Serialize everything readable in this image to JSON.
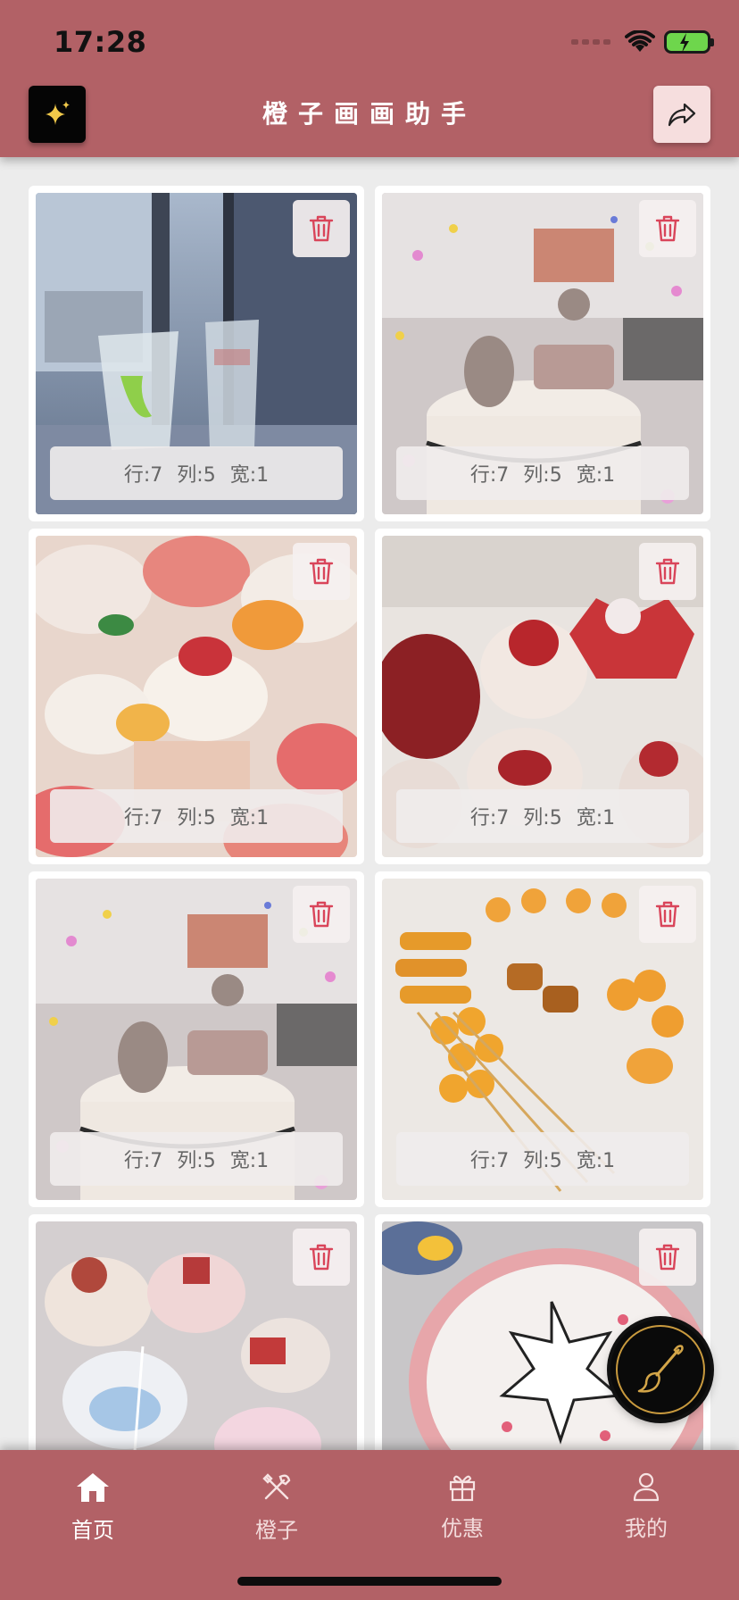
{
  "status": {
    "time": "17:28"
  },
  "header": {
    "title": "橙子画画助手",
    "magic_icon": "sparkles-icon",
    "share_icon": "share-icon"
  },
  "cards": [
    {
      "subject": "glasses-by-window",
      "rows": "行:7",
      "cols": "列:5",
      "width": "宽:1"
    },
    {
      "subject": "birthday-cake-confetti",
      "rows": "行:7",
      "cols": "列:5",
      "width": "宽:1"
    },
    {
      "subject": "fruit-cupcakes",
      "rows": "行:7",
      "cols": "列:5",
      "width": "宽:1"
    },
    {
      "subject": "strawberry-cupcakes-box",
      "rows": "行:7",
      "cols": "列:5",
      "width": "宽:1"
    },
    {
      "subject": "birthday-cake-confetti",
      "rows": "行:7",
      "cols": "列:5",
      "width": "宽:1"
    },
    {
      "subject": "bread-skewers",
      "rows": "行:7",
      "cols": "列:5",
      "width": "宽:1"
    },
    {
      "subject": "decorated-mini-cakes",
      "rows": "",
      "cols": "",
      "width": ""
    },
    {
      "subject": "star-cake",
      "rows": "",
      "cols": "",
      "width": ""
    }
  ],
  "fab": {
    "icon": "paintbrush-icon"
  },
  "tabs": [
    {
      "label": "首页",
      "icon": "home-icon",
      "active": true
    },
    {
      "label": "橙子",
      "icon": "tools-icon",
      "active": false
    },
    {
      "label": "优惠",
      "icon": "gift-icon",
      "active": false
    },
    {
      "label": "我的",
      "icon": "person-icon",
      "active": false
    }
  ],
  "colors": {
    "brand": "#b26166",
    "delete": "#d9455a",
    "background": "#ececec"
  }
}
